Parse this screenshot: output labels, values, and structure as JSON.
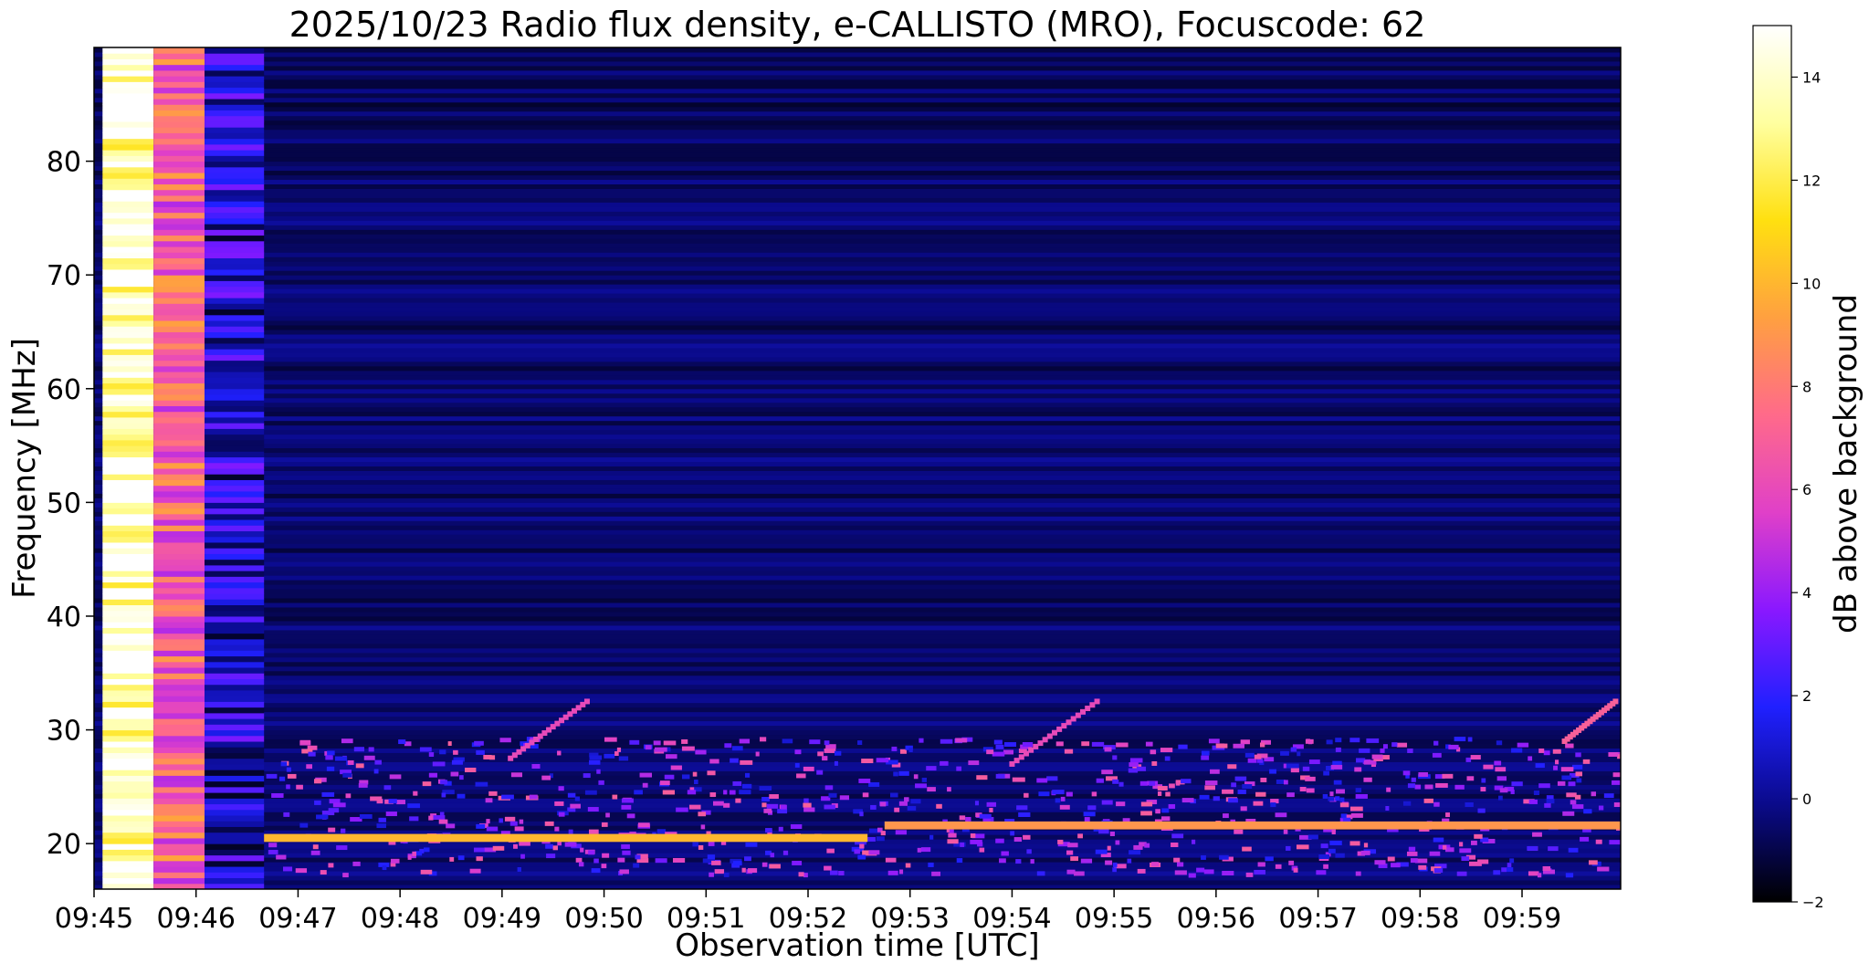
{
  "chart_data": {
    "type": "heatmap",
    "title": "2025/10/23  Radio flux density, e-CALLISTO (MRO), Focuscode: 62",
    "xlabel": "Observation time [UTC]",
    "ylabel": "Frequency [MHz]",
    "x_ticks": [
      "09:45",
      "09:46",
      "09:47",
      "09:48",
      "09:49",
      "09:50",
      "09:51",
      "09:52",
      "09:53",
      "09:54",
      "09:55",
      "09:56",
      "09:57",
      "09:58",
      "09:59"
    ],
    "y_ticks": [
      20,
      30,
      40,
      50,
      60,
      70,
      80
    ],
    "ylim": [
      16,
      90
    ],
    "xlim": [
      "09:45",
      "09:59:58"
    ],
    "colorbar": {
      "label": "dB above background",
      "ticks": [
        -2,
        0,
        2,
        4,
        6,
        8,
        10,
        12,
        14
      ],
      "range": [
        -2,
        15
      ],
      "colormap": "gnuplot2",
      "stops": [
        "#000000",
        "#0a0a8a",
        "#2020ff",
        "#8a18ff",
        "#e040c8",
        "#ff6a8a",
        "#ffa040",
        "#ffe010",
        "#ffffa0",
        "#ffffff"
      ]
    },
    "grid": false,
    "features": {
      "calibration_columns_dB": [
        {
          "start": "09:45:05",
          "end": "09:45:35",
          "level": 14
        },
        {
          "start": "09:45:35",
          "end": "09:46:05",
          "level": 7
        },
        {
          "start": "09:46:05",
          "end": "09:46:40",
          "level": 1
        }
      ],
      "background_dB": -0.5,
      "persistent_lines": [
        {
          "freq": 20.5,
          "start": "09:46:40",
          "end": "09:52:35",
          "level": 10
        },
        {
          "freq": 21.6,
          "start": "09:52:45",
          "end": "09:59:58",
          "level": 9
        }
      ],
      "drifting_bursts": [
        {
          "start_time": "09:49:05",
          "end_time": "09:49:50",
          "start_freq": 27.5,
          "end_freq": 32.5,
          "level": 6
        },
        {
          "start_time": "09:54:00",
          "end_time": "09:54:50",
          "start_freq": 27.0,
          "end_freq": 32.5,
          "level": 6
        },
        {
          "start_time": "09:59:25",
          "end_time": "09:59:55",
          "start_freq": 29.0,
          "end_freq": 32.5,
          "level": 7
        }
      ]
    }
  }
}
